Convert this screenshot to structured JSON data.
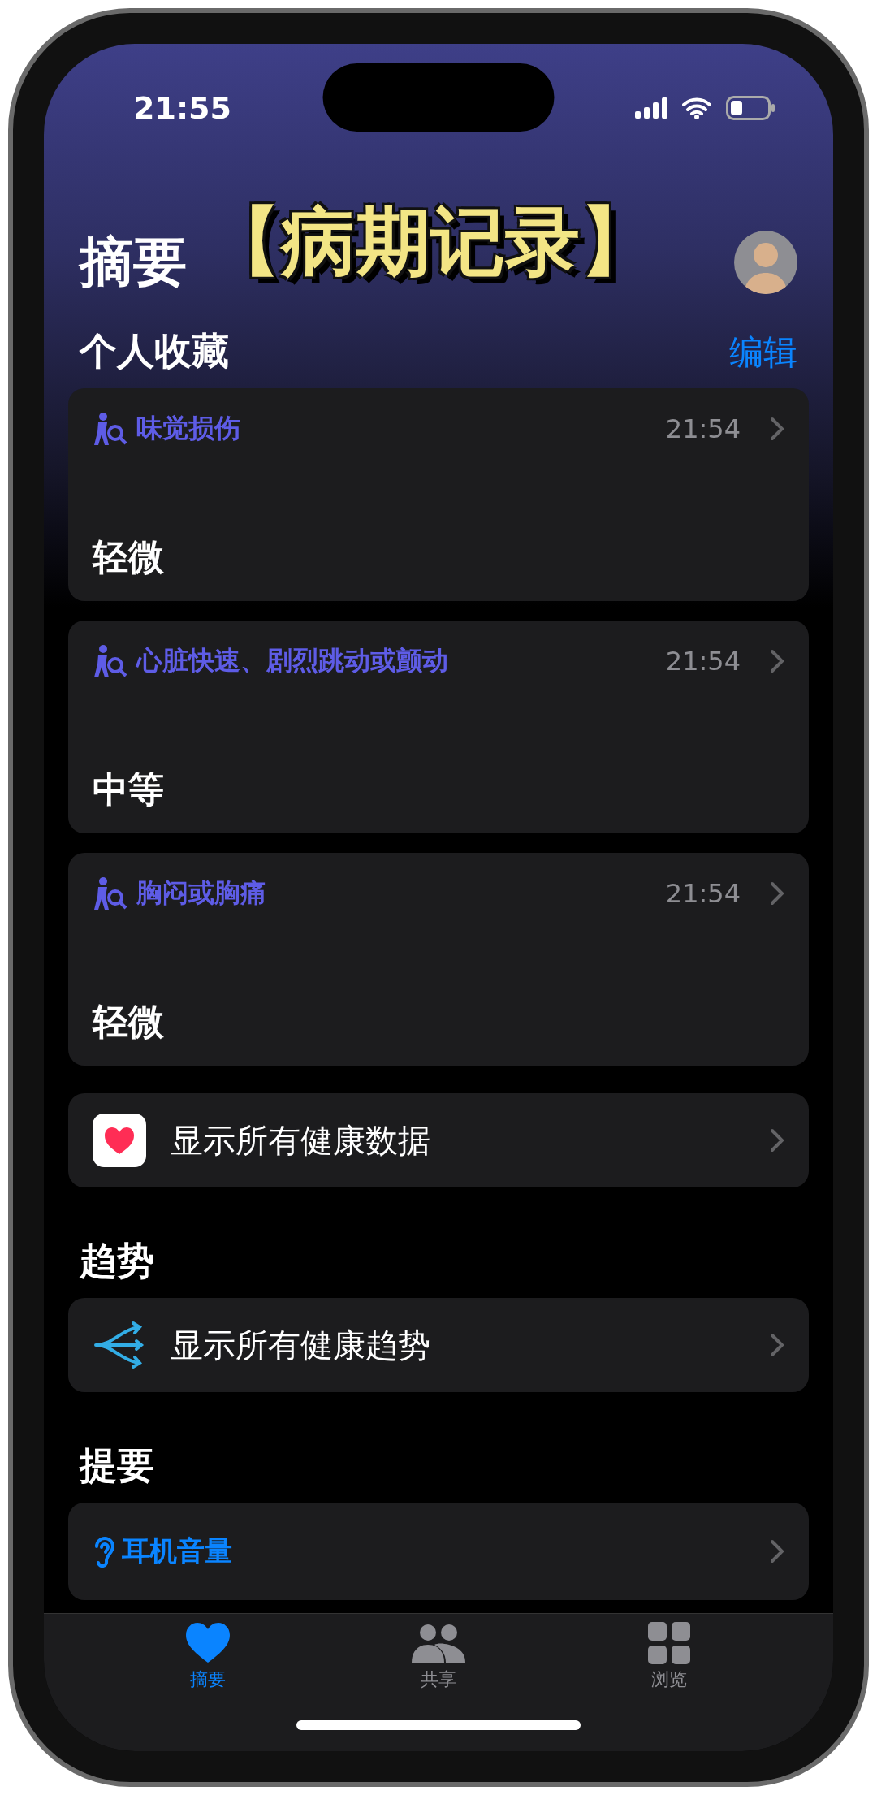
{
  "status_bar": {
    "time": "21:55"
  },
  "overlay_caption": "【病期记录】",
  "header": {
    "title": "摘要"
  },
  "favorites": {
    "title": "个人收藏",
    "edit": "编辑",
    "items": [
      {
        "name": "味觉损伤",
        "time": "21:54",
        "value": "轻微"
      },
      {
        "name": "心脏快速、剧烈跳动或颤动",
        "time": "21:54",
        "value": "中等"
      },
      {
        "name": "胸闷或胸痛",
        "time": "21:54",
        "value": "轻微"
      }
    ]
  },
  "all_data": {
    "label": "显示所有健康数据"
  },
  "trends": {
    "title": "趋势",
    "label": "显示所有健康趋势"
  },
  "highlights": {
    "title": "提要",
    "items": [
      {
        "name": "耳机音量"
      }
    ]
  },
  "tab_bar": [
    {
      "kind": "heart",
      "label": "摘要",
      "selected": true
    },
    {
      "kind": "people",
      "label": "共享",
      "selected": false
    },
    {
      "kind": "grid",
      "label": "浏览",
      "selected": false
    }
  ]
}
